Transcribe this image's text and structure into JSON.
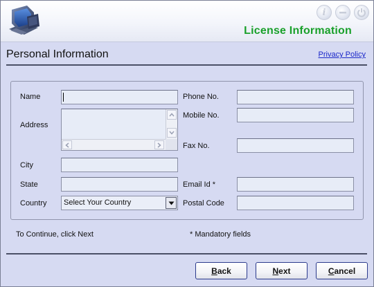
{
  "header": {
    "title": "License Information",
    "buttons": [
      {
        "name": "info-button",
        "icon": "info-icon",
        "glyph": "i"
      },
      {
        "name": "minimize-button",
        "icon": "minimize-icon"
      },
      {
        "name": "power-button",
        "icon": "power-icon"
      }
    ]
  },
  "section": {
    "title": "Personal Information",
    "privacy_link": "Privacy Policy"
  },
  "form": {
    "name_label": "Name",
    "address_label": "Address",
    "city_label": "City",
    "state_label": "State",
    "country_label": "Country",
    "phone_label": "Phone No.",
    "mobile_label": "Mobile No.",
    "fax_label": "Fax No.",
    "email_label": "Email Id *",
    "postal_label": "Postal Code",
    "name_value": "",
    "address_value": "",
    "city_value": "",
    "state_value": "",
    "phone_value": "",
    "mobile_value": "",
    "fax_value": "",
    "email_value": "",
    "postal_value": "",
    "country_selected": "Select Your Country"
  },
  "footer": {
    "continue_note": "To Continue, click Next",
    "mandatory_note": "* Mandatory fields",
    "back": {
      "mnemonic": "B",
      "rest": "ack"
    },
    "next": {
      "mnemonic": "N",
      "rest": "ext"
    },
    "cancel": {
      "mnemonic": "C",
      "rest": "ancel"
    }
  },
  "colors": {
    "background": "#d6daf2",
    "title_green": "#19a02a",
    "link_blue": "#1a27c9",
    "button_border": "#2b3a8c"
  }
}
